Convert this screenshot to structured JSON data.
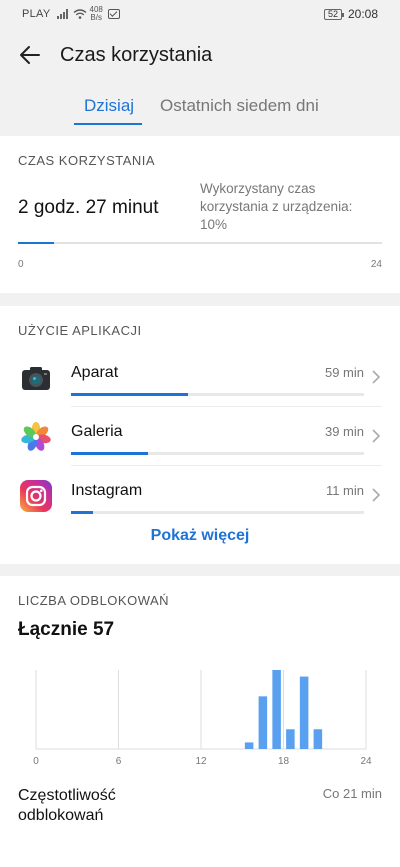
{
  "status_bar": {
    "carrier": "PLAY",
    "net_speed_value": "408",
    "net_speed_unit": "B/s",
    "battery": "52",
    "time": "20:08"
  },
  "header": {
    "title": "Czas korzystania",
    "back_icon": "arrow-left-icon"
  },
  "tabs": [
    {
      "label": "Dzisiaj",
      "active": true
    },
    {
      "label": "Ostatnich siedem dni",
      "active": false
    }
  ],
  "screen_time": {
    "section_title": "CZAS KORZYSTANIA",
    "total": "2 godz. 27 minut",
    "note": "Wykorzystany czas korzystania z urządzenia: 10%",
    "usage_fraction": 0.1,
    "axis_min": "0",
    "axis_max": "24"
  },
  "app_usage": {
    "section_title": "UŻYCIE APLIKACJI",
    "apps": [
      {
        "name": "Aparat",
        "time": "59 min",
        "minutes": 59,
        "icon": "camera-icon"
      },
      {
        "name": "Galeria",
        "time": "39 min",
        "minutes": 39,
        "icon": "gallery-flower-icon"
      },
      {
        "name": "Instagram",
        "time": "11 min",
        "minutes": 11,
        "icon": "instagram-icon"
      }
    ],
    "show_more": "Pokaż więcej"
  },
  "unlocks": {
    "section_title": "LICZBA ODBLOKOWAŃ",
    "total": "Łącznie 57",
    "frequency_label": "Częstotliwość odblokowań",
    "frequency_value": "Co 21 min"
  },
  "chart_data": {
    "type": "bar",
    "x_ticks": [
      "0",
      "6",
      "12",
      "18",
      "24"
    ],
    "xlim": [
      0,
      24
    ],
    "ylim": [
      0,
      12
    ],
    "hours": [
      15,
      16,
      17,
      18,
      19,
      20
    ],
    "values": [
      1,
      8,
      12,
      3,
      11,
      3
    ],
    "color": "#5aa0f0",
    "grid": true
  },
  "colors": {
    "accent": "#1e74d6",
    "bar": "#5aa0f0"
  }
}
